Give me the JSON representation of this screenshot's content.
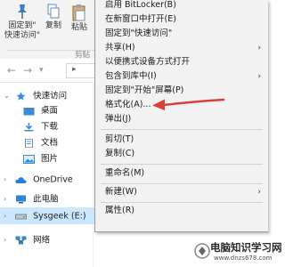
{
  "ribbon": {
    "pin_label_line1": "固定到\"",
    "pin_label_line2": "快速访问\"",
    "copy_label": "复制",
    "paste_label": "粘贴",
    "group_label": "剪贴"
  },
  "address_bar": {
    "back_glyph": "←",
    "forward_glyph": "→",
    "dropdown_glyph": "▾",
    "path_glyph": "▸"
  },
  "nav_tree": {
    "quick_access": "快速访问",
    "items": [
      "桌面",
      "下载",
      "文档",
      "图片"
    ],
    "onedrive": "OneDrive",
    "this_pc": "此电脑",
    "drive": "Sysgeek (E:)",
    "network": "网络"
  },
  "context_menu": {
    "items": [
      {
        "label": "启用 BitLocker(B)",
        "submenu": false
      },
      {
        "label": "在新窗口中打开(E)",
        "submenu": false
      },
      {
        "label": "固定到\"快速访问\"",
        "submenu": false
      },
      {
        "label": "共享(H)",
        "submenu": true
      },
      {
        "label": "以便携式设备方式打开",
        "submenu": false
      },
      {
        "label": "包含到库中(I)",
        "submenu": true
      },
      {
        "label": "固定到\"开始\"屏幕(P)",
        "submenu": false
      },
      {
        "label": "格式化(A)...",
        "submenu": false
      },
      {
        "label": "弹出(J)",
        "submenu": false
      },
      {
        "label": "剪切(T)",
        "submenu": false
      },
      {
        "label": "复制(C)",
        "submenu": false
      },
      {
        "label": "重命名(M)",
        "submenu": false
      },
      {
        "label": "新建(W)",
        "submenu": true
      },
      {
        "label": "属性(R)",
        "submenu": false
      }
    ],
    "submenu_glyph": "›"
  },
  "watermark": {
    "title": "电脑知识学习网",
    "url": "www.dnzs678.com"
  },
  "colors": {
    "annotation_arrow": "#d9403a",
    "selection": "#cce8ff",
    "folder": "#e8b730",
    "menu_bg": "#f2f2f2"
  }
}
